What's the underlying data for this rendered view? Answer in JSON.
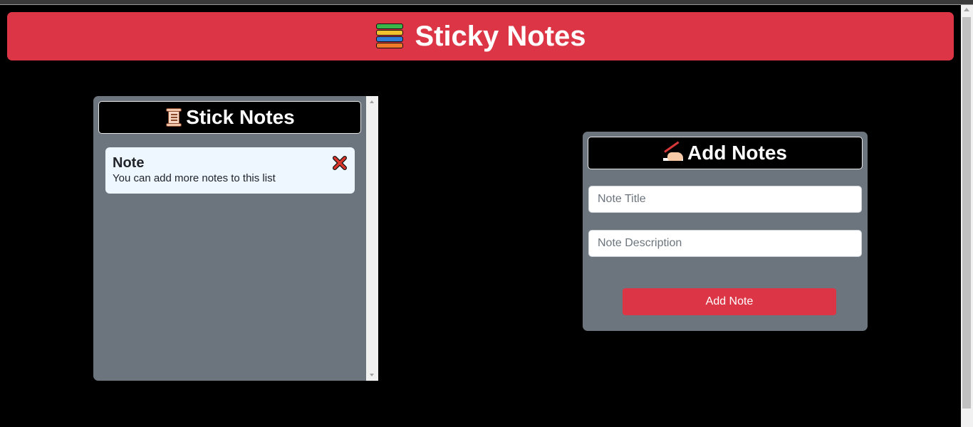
{
  "header": {
    "title": "Sticky Notes",
    "icon": "books-icon"
  },
  "notes_panel": {
    "title": "Stick Notes",
    "icon": "scroll-icon",
    "notes": [
      {
        "title": "Note",
        "description": "You can add more notes to this list"
      }
    ]
  },
  "add_panel": {
    "title": "Add Notes",
    "icon": "writing-hand-icon",
    "title_placeholder": "Note Title",
    "description_placeholder": "Note Description",
    "button_label": "Add Note"
  },
  "colors": {
    "accent": "#dc3545",
    "panel": "#6c757d",
    "background": "#000000",
    "note_card": "#eef6ff"
  }
}
